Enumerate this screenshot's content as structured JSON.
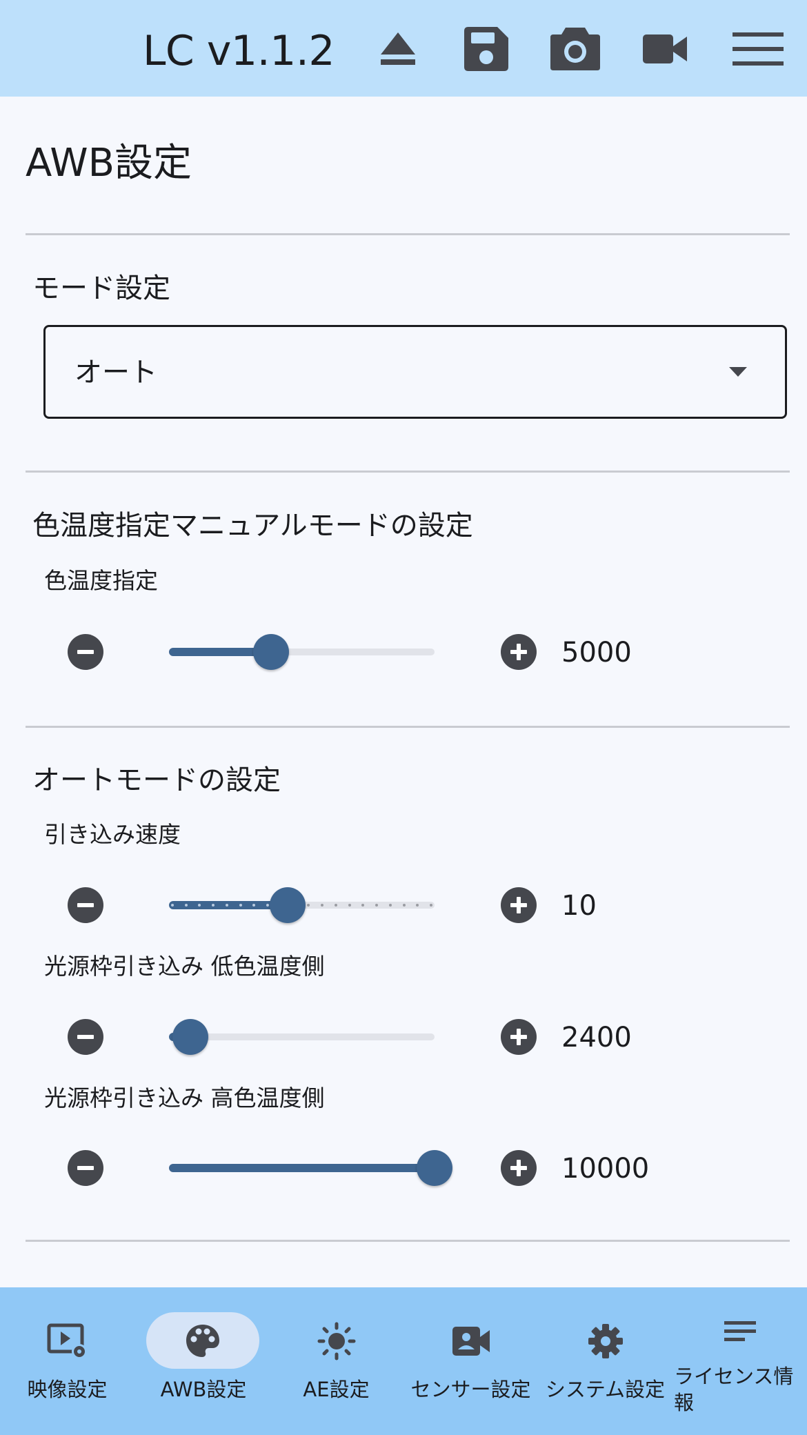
{
  "header": {
    "title": "LC v1.1.2",
    "icons": [
      "eject-icon",
      "save-icon",
      "camera-icon",
      "videocam-icon",
      "menu-icon"
    ]
  },
  "page": {
    "heading": "AWB設定"
  },
  "mode_section": {
    "label": "モード設定",
    "selected": "オート"
  },
  "manual_section": {
    "title": "色温度指定マニュアルモードの設定",
    "sliders": [
      {
        "label": "色温度指定",
        "value": "5000",
        "fraction": 0.385,
        "ticks": false
      }
    ]
  },
  "auto_section": {
    "title": "オートモードの設定",
    "sliders": [
      {
        "label": "引き込み速度",
        "value": "10",
        "fraction": 0.448,
        "ticks": true
      },
      {
        "label": "光源枠引き込み 低色温度側",
        "value": "2400",
        "fraction": 0.08,
        "ticks": false
      },
      {
        "label": "光源枠引き込み 高色温度側",
        "value": "10000",
        "fraction": 1.0,
        "ticks": false
      }
    ]
  },
  "bottom_nav": {
    "active_index": 1,
    "items": [
      {
        "label": "映像設定",
        "icon": "video-settings-icon"
      },
      {
        "label": "AWB設定",
        "icon": "palette-icon"
      },
      {
        "label": "AE設定",
        "icon": "brightness-icon"
      },
      {
        "label": "センサー設定",
        "icon": "video-camera-user-icon"
      },
      {
        "label": "システム設定",
        "icon": "gear-icon"
      },
      {
        "label": "ライセンス情報",
        "icon": "notes-icon"
      }
    ]
  },
  "colors": {
    "topbar": "#bde0fb",
    "bottom_nav": "#90c8f6",
    "accent": "#3e6590",
    "icon": "#45474d"
  }
}
